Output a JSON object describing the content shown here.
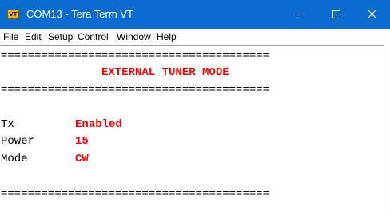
{
  "window": {
    "title": "COM13 - Tera Term VT",
    "icon_label": "VT",
    "icon": "teraterm-app-icon",
    "titlebar_color": "#0a6bd0",
    "buttons": {
      "minimize": "minimize-icon",
      "maximize": "maximize-icon",
      "close": "close-icon"
    }
  },
  "menu": {
    "items": [
      "File",
      "Edit",
      "Setup",
      "Control",
      "Window",
      "Help"
    ]
  },
  "terminal": {
    "separator": "========================================",
    "heading": "EXTERNAL TUNER MODE",
    "rows": [
      {
        "label": "Tx",
        "value": "Enabled"
      },
      {
        "label": "Power",
        "value": "15"
      },
      {
        "label": "Mode",
        "value": "CW"
      }
    ],
    "value_color": "#ff0000"
  }
}
